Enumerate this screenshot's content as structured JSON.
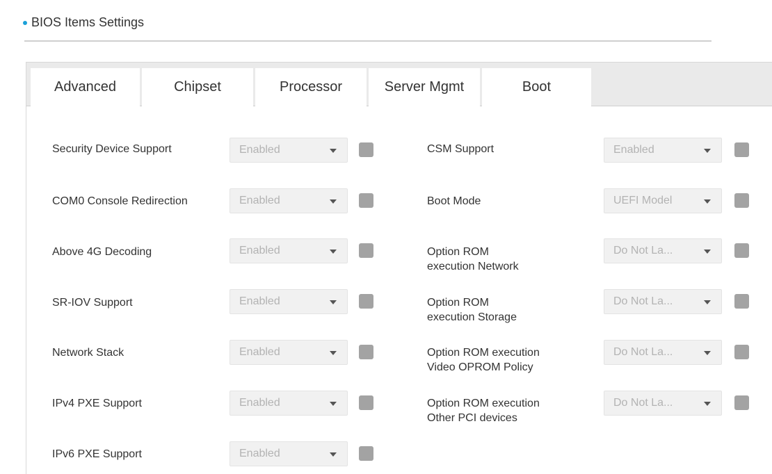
{
  "section": {
    "title": "BIOS Items Settings"
  },
  "tabs": [
    {
      "label": "Advanced"
    },
    {
      "label": "Chipset"
    },
    {
      "label": "Processor"
    },
    {
      "label": "Server Mgmt"
    },
    {
      "label": "Boot"
    }
  ],
  "left_settings": [
    {
      "label": "Security Device Support",
      "value": "Enabled"
    },
    {
      "label": "COM0 Console Redirection",
      "value": "Enabled"
    },
    {
      "label": "Above 4G Decoding",
      "value": "Enabled"
    },
    {
      "label": "SR-IOV Support",
      "value": "Enabled"
    },
    {
      "label": "Network Stack",
      "value": "Enabled"
    },
    {
      "label": "IPv4 PXE Support",
      "value": "Enabled"
    },
    {
      "label": "IPv6 PXE Support",
      "value": "Enabled"
    }
  ],
  "right_settings": [
    {
      "label_line1": "CSM Support",
      "label_line2": "",
      "value": "Enabled"
    },
    {
      "label_line1": "Boot Mode",
      "label_line2": "",
      "value": "UEFI Model"
    },
    {
      "label_line1": "Option ROM",
      "label_line2": "execution Network",
      "value": "Do Not La..."
    },
    {
      "label_line1": "Option ROM",
      "label_line2": "execution Storage",
      "value": "Do Not La..."
    },
    {
      "label_line1": "Option ROM execution",
      "label_line2": "Video OPROM Policy",
      "value": "Do Not La..."
    },
    {
      "label_line1": "Option ROM execution",
      "label_line2": "Other PCI devices",
      "value": "Do Not La..."
    }
  ],
  "icons": {
    "select_caret": "caret-down-icon",
    "bullet": "bullet-icon",
    "checkbox": "checkbox-icon"
  },
  "colors": {
    "accent": "#1aa0d8",
    "checkbox": "#a3a3a3",
    "disabled_text": "#b3b3b3"
  }
}
